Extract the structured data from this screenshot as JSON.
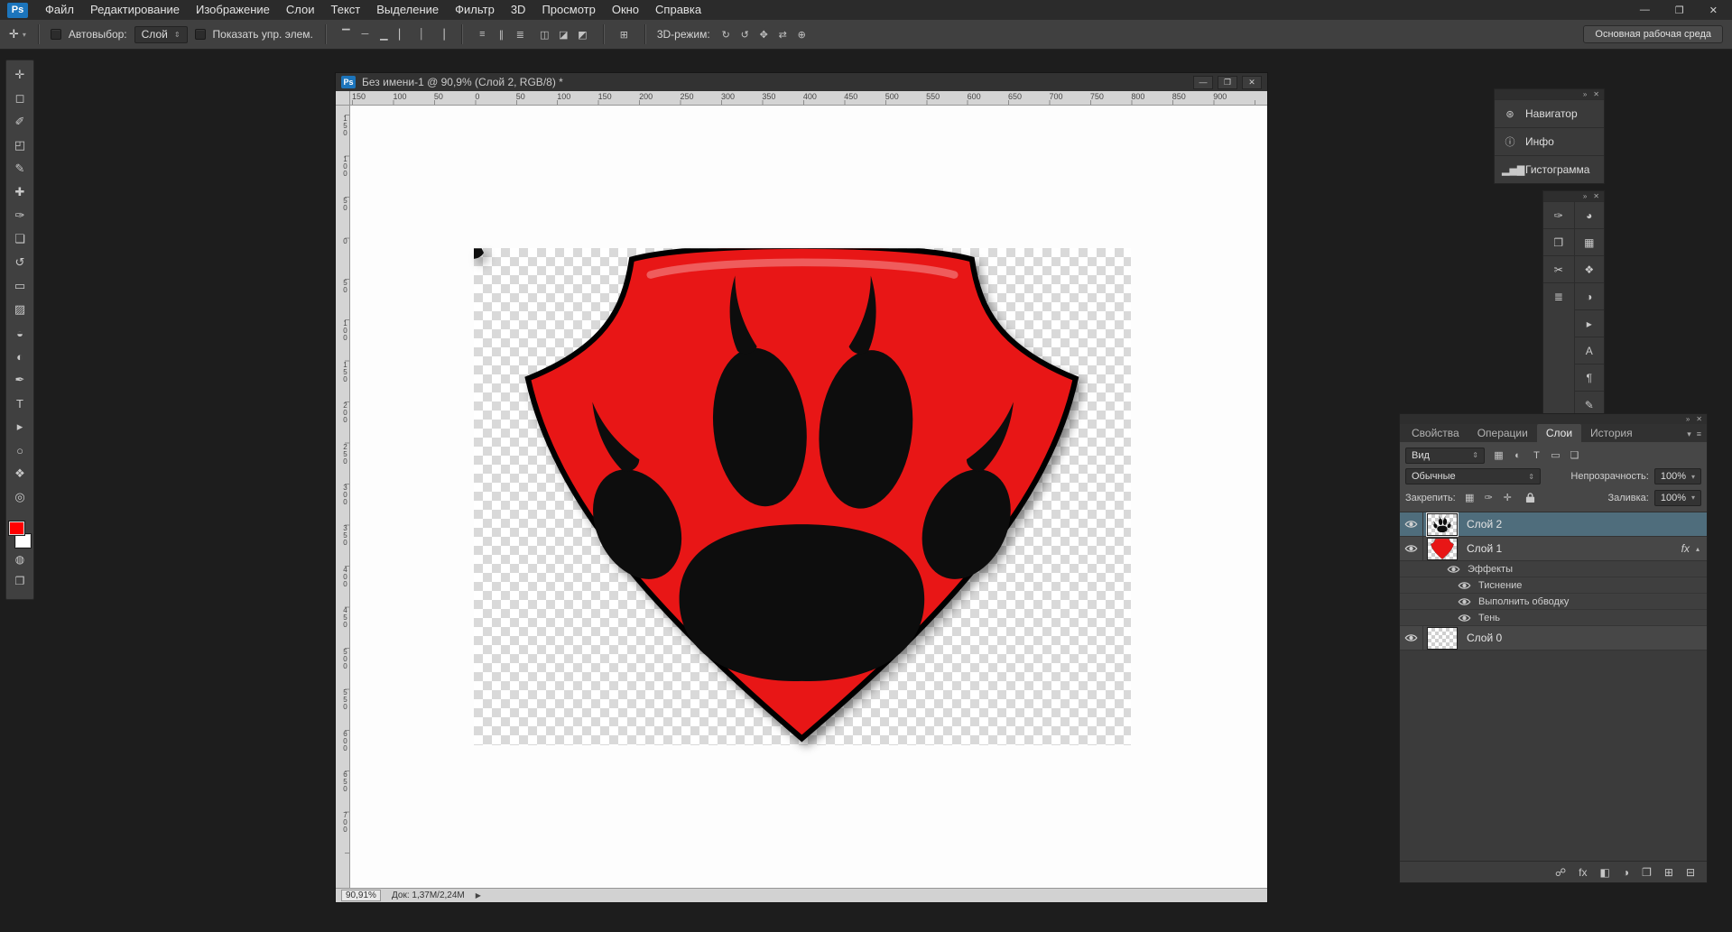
{
  "app": {
    "logo_text": "Ps",
    "window_controls": {
      "minimize": "—",
      "maximize": "❐",
      "close": "✕"
    }
  },
  "menubar": {
    "items": [
      "Файл",
      "Редактирование",
      "Изображение",
      "Слои",
      "Текст",
      "Выделение",
      "Фильтр",
      "3D",
      "Просмотр",
      "Окно",
      "Справка"
    ]
  },
  "options_bar": {
    "active_tool_glyph": "✛",
    "tool_dd_arrow": "▾",
    "autoselect_label": "Автовыбор:",
    "autoselect_target": "Слой",
    "show_controls_label": "Показать упр. элем.",
    "align_icons": [
      {
        "name": "align-top-edges-icon",
        "glyph": "▔"
      },
      {
        "name": "align-vertical-centers-icon",
        "glyph": "─"
      },
      {
        "name": "align-bottom-edges-icon",
        "glyph": "▁"
      },
      {
        "name": "align-left-edges-icon",
        "glyph": "▏"
      },
      {
        "name": "align-horizontal-centers-icon",
        "glyph": "│"
      },
      {
        "name": "align-right-edges-icon",
        "glyph": "▕"
      }
    ],
    "distribute_icons": [
      {
        "name": "distribute-top-edges-icon",
        "glyph": "≡"
      },
      {
        "name": "distribute-vertical-centers-icon",
        "glyph": "∥"
      },
      {
        "name": "distribute-bottom-edges-icon",
        "glyph": "≣"
      }
    ],
    "distribute_spacing_icons": [
      {
        "name": "distribute-left-edges-icon",
        "glyph": "◫"
      },
      {
        "name": "distribute-horizontal-centers-icon",
        "glyph": "◪"
      },
      {
        "name": "distribute-right-edges-icon",
        "glyph": "◩"
      }
    ],
    "auto_align_glyph": "⊞",
    "mode3d_label": "3D-режим:",
    "mode3d_icons": [
      {
        "name": "3d-rotate-icon",
        "glyph": "↻"
      },
      {
        "name": "3d-roll-icon",
        "glyph": "↺"
      },
      {
        "name": "3d-pan-icon",
        "glyph": "✥"
      },
      {
        "name": "3d-slide-icon",
        "glyph": "⇄"
      },
      {
        "name": "3d-zoom-icon",
        "glyph": "⊕"
      }
    ],
    "workspace_button_label": "Основная рабочая среда",
    "workspace_dd_arrow": "▾"
  },
  "toolbox": {
    "tools": [
      {
        "name": "move-tool",
        "glyph": "✛"
      },
      {
        "name": "marquee-tool",
        "glyph": "◻"
      },
      {
        "name": "lasso-tool",
        "glyph": "✐"
      },
      {
        "name": "crop-tool",
        "glyph": "◰"
      },
      {
        "name": "eyedropper-tool",
        "glyph": "✎"
      },
      {
        "name": "healing-brush-tool",
        "glyph": "✚"
      },
      {
        "name": "brush-tool",
        "glyph": "✑"
      },
      {
        "name": "clone-stamp-tool",
        "glyph": "❏"
      },
      {
        "name": "history-brush-tool",
        "glyph": "↺"
      },
      {
        "name": "eraser-tool",
        "glyph": "▭"
      },
      {
        "name": "gradient-tool",
        "glyph": "▨"
      },
      {
        "name": "blur-tool",
        "glyph": "◒"
      },
      {
        "name": "dodge-tool",
        "glyph": "◐"
      },
      {
        "name": "pen-tool",
        "glyph": "✒"
      },
      {
        "name": "type-tool",
        "glyph": "T"
      },
      {
        "name": "path-selection-tool",
        "glyph": "▸"
      },
      {
        "name": "shape-tool",
        "glyph": "○"
      },
      {
        "name": "hand-tool",
        "glyph": "❖"
      },
      {
        "name": "zoom-tool",
        "glyph": "◎"
      }
    ],
    "quick_mask_glyph": "◍",
    "screen_mode_glyph": "❐",
    "foreground_color": "#ff0000",
    "background_color": "#ffffff"
  },
  "document": {
    "doc_icon_text": "Ps",
    "title": "Без имени-1 @ 90,9% (Слой 2, RGB/8) *",
    "ruler_top": [
      "150",
      "100",
      "50",
      "0",
      "50",
      "100",
      "150",
      "200",
      "250",
      "300",
      "350",
      "400",
      "450",
      "500",
      "550",
      "600",
      "650",
      "700",
      "750",
      "800",
      "850",
      "900"
    ],
    "ruler_left": [
      "150",
      "100",
      "50",
      "0",
      "50",
      "100",
      "150",
      "200",
      "250",
      "300",
      "350",
      "400",
      "450",
      "500",
      "550",
      "600",
      "650",
      "700"
    ],
    "status_zoom": "90,91%",
    "status_doc": "Док: 1,37M/2,24M",
    "status_arrow": "▶"
  },
  "artwork": {
    "shield_fill": "#e81616",
    "outline": "#000000",
    "paw_fill": "#0d0d0d"
  },
  "panels": {
    "dock_header": {
      "collapse_glyph": "»",
      "close_glyph": "✕"
    },
    "collapsed_group": [
      {
        "name": "panel-button-navigator",
        "icon_glyph": "⊛",
        "label": "Навигатор"
      },
      {
        "name": "panel-button-info",
        "icon_glyph": "ⓘ",
        "label": "Инфо"
      },
      {
        "name": "panel-button-histogram",
        "icon_glyph": "▂▅▇",
        "label": "Гистограмма"
      }
    ],
    "icon_dock_left": [
      {
        "name": "brush-presets-panel-icon",
        "glyph": "✑"
      },
      {
        "name": "clone-source-panel-icon",
        "glyph": "❐"
      },
      {
        "name": "tool-presets-panel-icon",
        "glyph": "✂"
      },
      {
        "name": "layer-comps-panel-icon",
        "glyph": "≣"
      }
    ],
    "icon_dock_right": [
      {
        "name": "color-panel-icon",
        "glyph": "◕"
      },
      {
        "name": "swatches-panel-icon",
        "glyph": "▦"
      },
      {
        "name": "styles-panel-icon",
        "glyph": "❖"
      },
      {
        "name": "adjustments-panel-icon",
        "glyph": "◑"
      },
      {
        "name": "actions-panel-icon",
        "glyph": "▸"
      },
      {
        "name": "character-panel-icon",
        "glyph": "A"
      },
      {
        "name": "paragraph-panel-icon",
        "glyph": "¶"
      },
      {
        "name": "notes-panel-icon",
        "glyph": "✎"
      }
    ],
    "layers_panel": {
      "tabs": [
        "Свойства",
        "Операции",
        "Слои",
        "История"
      ],
      "tab_menu_glyphs": {
        "chevron": "▾",
        "menu": "≡"
      },
      "kind_filter_value": "Вид",
      "dd_arrows": "⇕",
      "filter_icons": [
        {
          "name": "filter-pixel-layers-icon",
          "glyph": "▦"
        },
        {
          "name": "filter-adjustment-layers-icon",
          "glyph": "◐"
        },
        {
          "name": "filter-type-layers-icon",
          "glyph": "T"
        },
        {
          "name": "filter-shape-layers-icon",
          "glyph": "▭"
        },
        {
          "name": "filter-smart-objects-icon",
          "glyph": "❏"
        }
      ],
      "blend_mode_value": "Обычные",
      "opacity_label": "Непрозрачность:",
      "opacity_value": "100%",
      "lock_label": "Закрепить:",
      "lock_icons": [
        {
          "name": "lock-transparency-icon",
          "glyph": "▦"
        },
        {
          "name": "lock-pixels-icon",
          "glyph": "✑"
        },
        {
          "name": "lock-position-icon",
          "glyph": "✛"
        }
      ],
      "fill_label": "Заливка:",
      "fill_value": "100%",
      "layer2_name": "Слой 2",
      "layer1_name": "Слой 1",
      "layer0_name": "Слой 0",
      "fx_badge": "fx",
      "fx_collapse_glyph": "▴",
      "effects_header": "Эффекты",
      "effects": [
        "Тиснение",
        "Выполнить обводку",
        "Тень"
      ],
      "bottom_icons": [
        {
          "name": "link-layers-icon",
          "glyph": "☍"
        },
        {
          "name": "layer-style-icon",
          "glyph": "fx"
        },
        {
          "name": "add-layer-mask-icon",
          "glyph": "◧"
        },
        {
          "name": "adjustment-layer-icon",
          "glyph": "◑"
        },
        {
          "name": "new-group-icon",
          "glyph": "❐"
        },
        {
          "name": "new-layer-icon",
          "glyph": "⊞"
        },
        {
          "name": "delete-layer-icon",
          "glyph": "⊟"
        }
      ]
    }
  }
}
